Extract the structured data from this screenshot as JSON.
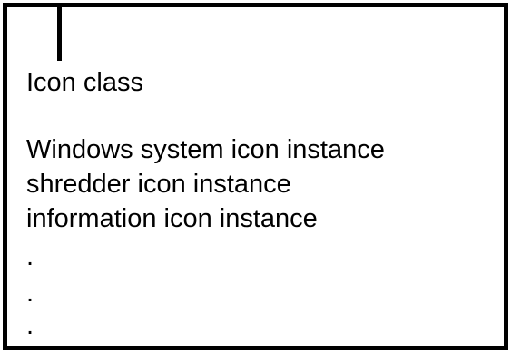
{
  "class_box": {
    "title": "Icon class",
    "instances": [
      "Windows system icon instance",
      "shredder icon instance",
      "information icon instance"
    ],
    "ellipsis": [
      ".",
      ".",
      "."
    ]
  }
}
